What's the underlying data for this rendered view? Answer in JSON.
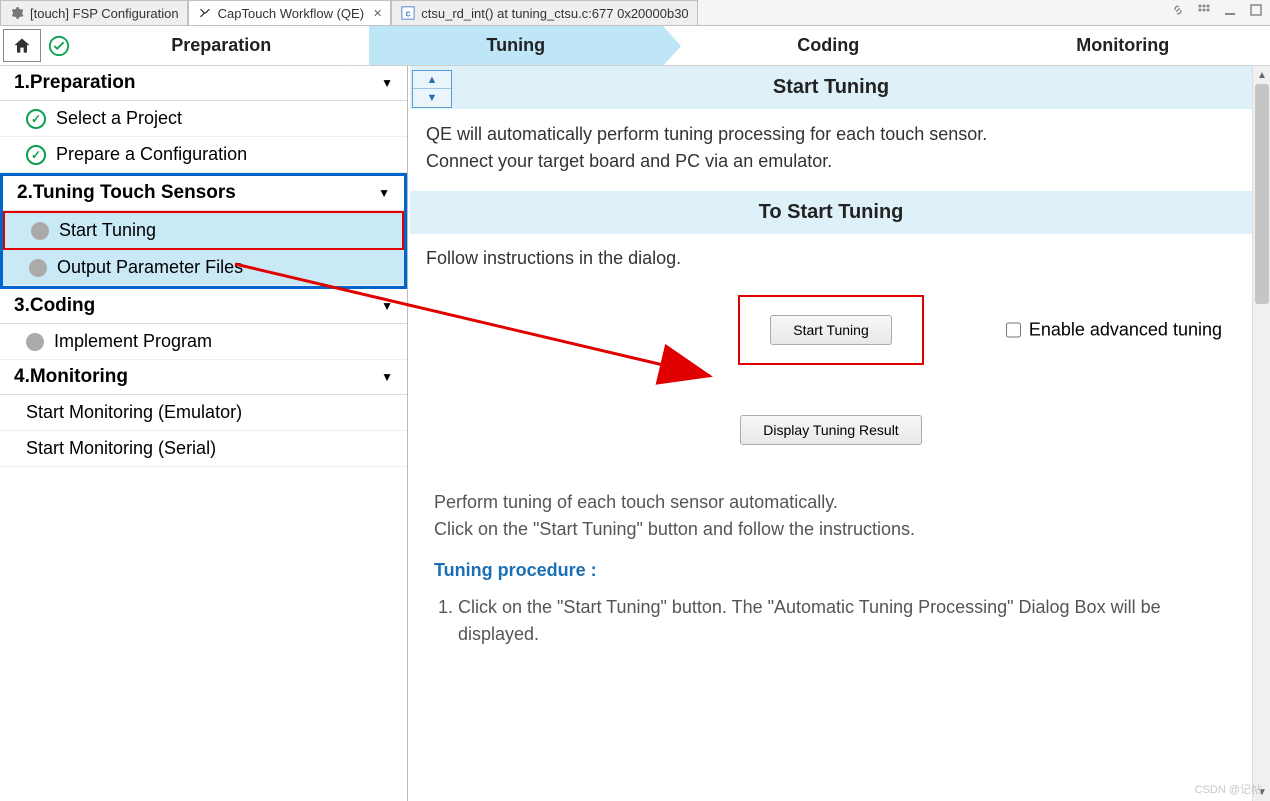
{
  "tabs": [
    {
      "label": "[touch] FSP Configuration"
    },
    {
      "label": "CapTouch Workflow (QE)"
    },
    {
      "label": "ctsu_rd_int() at tuning_ctsu.c:677 0x20000b30"
    }
  ],
  "workflow": {
    "steps": [
      "Preparation",
      "Tuning",
      "Coding",
      "Monitoring"
    ]
  },
  "sidebar": {
    "s1": {
      "title": "1.Preparation",
      "items": [
        "Select a Project",
        "Prepare a Configuration"
      ]
    },
    "s2": {
      "title": "2.Tuning Touch Sensors",
      "items": [
        "Start Tuning",
        "Output Parameter Files"
      ]
    },
    "s3": {
      "title": "3.Coding",
      "items": [
        "Implement Program"
      ]
    },
    "s4": {
      "title": "4.Monitoring",
      "items": [
        "Start Monitoring (Emulator)",
        "Start Monitoring (Serial)"
      ]
    }
  },
  "main": {
    "heading1": "Start Tuning",
    "desc_line1": "QE will automatically perform tuning processing for each touch sensor.",
    "desc_line2": "Connect your target board and PC via an emulator.",
    "heading2": "To Start Tuning",
    "follow": "Follow instructions in the dialog.",
    "start_btn": "Start Tuning",
    "enable_adv": "Enable advanced tuning",
    "display_btn": "Display Tuning Result",
    "footer1": "Perform tuning of each touch sensor automatically.",
    "footer2": "Click on the \"Start Tuning\" button and follow the instructions.",
    "proc_title": "Tuning procedure :",
    "proc_step1": "Click on the \"Start Tuning\" button. The \"Automatic Tuning Processing\" Dialog Box will be displayed."
  },
  "watermark": "CSDN @记帖"
}
